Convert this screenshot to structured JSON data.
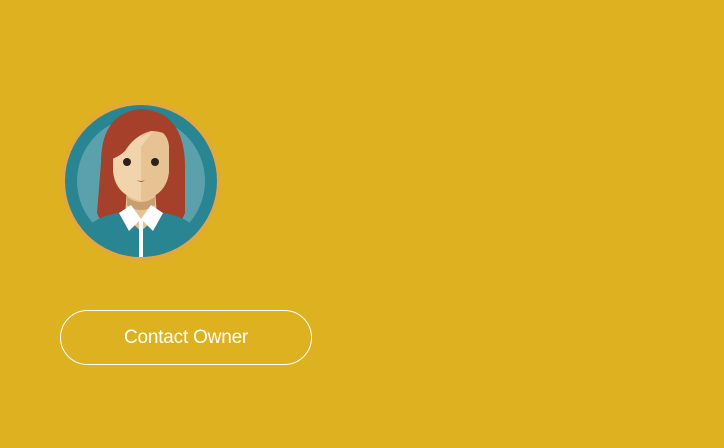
{
  "page": {
    "background_color": "#DDB120"
  },
  "profile": {
    "avatar_icon": "woman-avatar-icon",
    "contact_button_label": "Contact Owner"
  }
}
